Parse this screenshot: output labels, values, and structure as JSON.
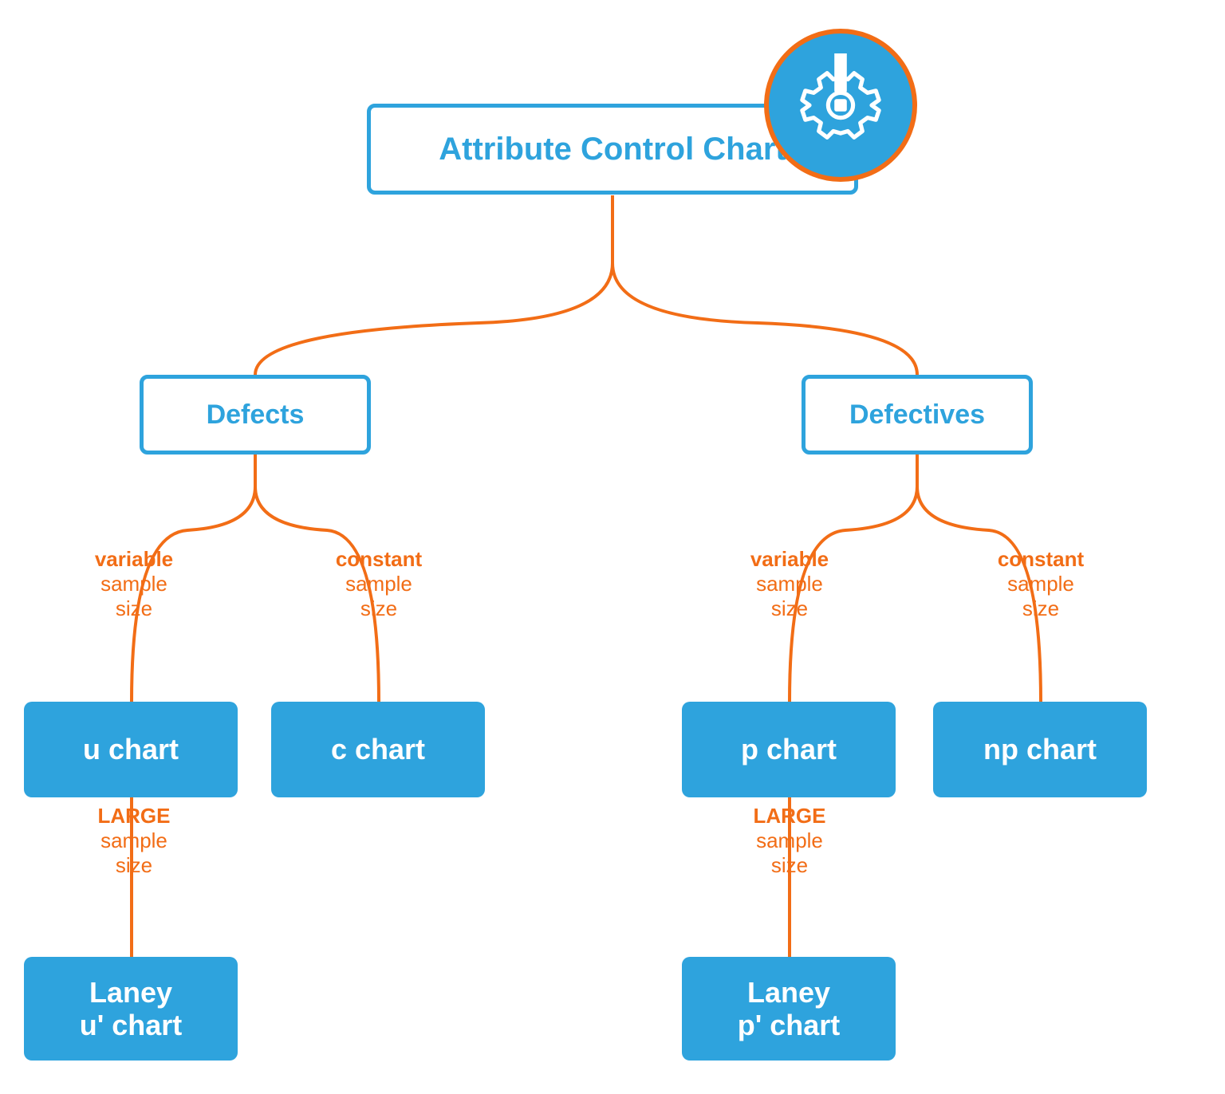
{
  "root": {
    "label": "Attribute Control Chart"
  },
  "categories": {
    "defects": {
      "label": "Defects"
    },
    "defectives": {
      "label": "Defectives"
    }
  },
  "connectors": {
    "variable": {
      "bold": "variable",
      "line1": "sample",
      "line2": "size"
    },
    "constant": {
      "bold": "constant",
      "line1": "sample",
      "line2": "size"
    },
    "large": {
      "bold": "LARGE",
      "line1": "sample",
      "line2": "size"
    }
  },
  "charts": {
    "u": {
      "label": "u chart"
    },
    "c": {
      "label": "c chart"
    },
    "p": {
      "label": "p chart"
    },
    "np": {
      "label": "np chart"
    },
    "laney_u": {
      "line1": "Laney",
      "line2": "u' chart"
    },
    "laney_p": {
      "line1": "Laney",
      "line2": "p' chart"
    }
  },
  "icon": {
    "name": "gear-alert-icon"
  }
}
